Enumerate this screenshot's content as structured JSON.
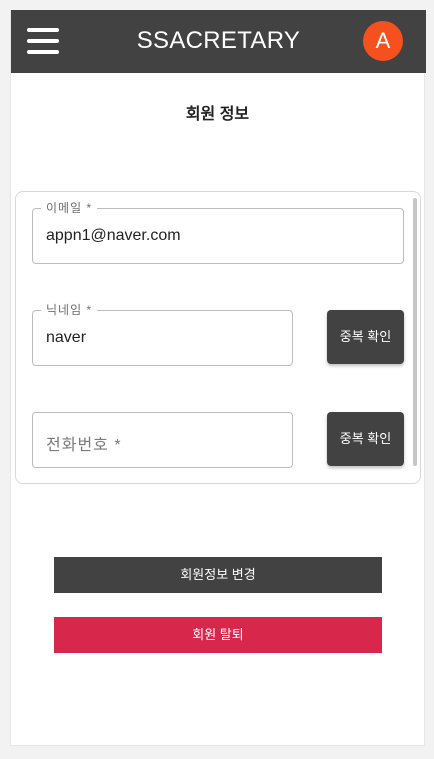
{
  "appbar": {
    "title": "SSACRETARY",
    "avatar_letter": "A",
    "avatar_color": "#f4511e",
    "background": "#424242",
    "menu_icon": "hamburger-menu-icon"
  },
  "page": {
    "title": "회원 정보"
  },
  "form": {
    "email": {
      "label": "이메일 *",
      "value": "appn1@naver.com"
    },
    "nickname": {
      "label": "닉네임 *",
      "value": "naver",
      "check_label": "중복 확인"
    },
    "phone": {
      "placeholder": "전화번호 *",
      "value": "",
      "check_label": "중복 확인"
    }
  },
  "actions": {
    "update_label": "회원정보 변경",
    "update_color": "#424242",
    "withdraw_label": "회원 탈퇴",
    "withdraw_color": "#d7284b"
  }
}
